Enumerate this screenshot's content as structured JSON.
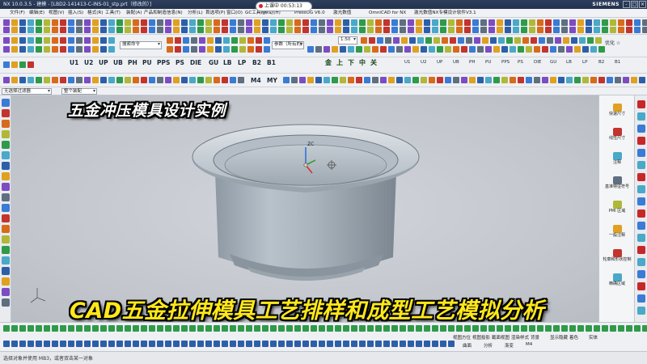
{
  "window": {
    "title": "NX 10.0.3.5 - 建模 - [LBD2-141413-C-INS-01_stp.prt（修改的）]",
    "brand": "SIEMENS",
    "min_label": "-",
    "max_label": "□",
    "close_label": "×"
  },
  "timer": {
    "label": "上课中 00:53:13"
  },
  "menubar": {
    "items": [
      "文件(F)",
      "编辑(E)",
      "视图(V)",
      "插入(S)",
      "格式(R)",
      "工具(T)",
      "装配(A)",
      "产品和制造信息(N)",
      "分析(L)",
      "首选项(P)",
      "窗口(O)",
      "GC工具箱",
      "帮助(H)",
      "PressUG V6.0",
      "激光数值",
      "OmniCAD for NX",
      "激光数值NX专模设计软件V3.1"
    ]
  },
  "toolbar_row2": {
    "search_placeholder": "搜索命令",
    "ref_label": "参数（所有的）",
    "scale_value": "1:50",
    "group_label": "优化 ☆"
  },
  "toolbar_row3": {
    "labels": [
      "U1",
      "U2",
      "UP",
      "UB",
      "PH",
      "PU",
      "PPS",
      "PS",
      "DIE",
      "GU",
      "LB",
      "LP",
      "B2",
      "B1"
    ],
    "dirs": [
      "金",
      "上",
      "下",
      "中",
      "关"
    ],
    "right_labels": [
      "U1",
      "U2",
      "UP",
      "UB",
      "PH",
      "PU",
      "PPS",
      "PS",
      "DIE",
      "GU",
      "LB",
      "LP",
      "B2",
      "B1"
    ]
  },
  "toolbar_row4": {
    "labels": [
      "M4",
      "MY"
    ]
  },
  "selection_bar": {
    "filter": "无选择过滤器",
    "scope": "整个装配"
  },
  "right_panel": {
    "items": [
      "快速尺寸",
      "线性尺寸",
      "注释",
      "基准特征符号",
      "PMI 区域",
      "一般注释",
      "轮廓和形状控制",
      "精确区域"
    ]
  },
  "overlay": {
    "top": "五金冲压模具设计实例",
    "bottom": "CAD五金拉伸模具工艺排样和成型工艺模拟分析"
  },
  "axis": {
    "label": "ZC"
  },
  "bottom_toolbar": {
    "labels": [
      "视图方位",
      "视图投影",
      "截面视图",
      "渲染样式",
      "背景",
      "显示隐藏",
      "着色",
      "实体",
      "曲面",
      "分析",
      "渐变",
      "M4"
    ]
  },
  "status": {
    "text": "选择对象并使用 MB3，或者双击某一对象"
  },
  "colors": {
    "accent": "#1f6fd1",
    "title_bg": "#2e3f5e",
    "caption_top": "#ffffff",
    "caption_bottom": "#ffe81a"
  }
}
